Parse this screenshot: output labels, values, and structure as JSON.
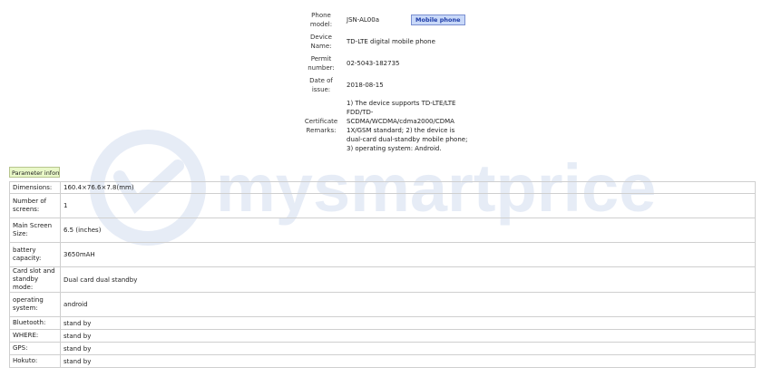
{
  "watermark": {
    "text": "mysmartprice"
  },
  "certificate": {
    "rows": [
      {
        "label": "Phone model:",
        "value": "JSN-AL00a",
        "tag": "Mobile phone"
      },
      {
        "label": "Device Name:",
        "value": "TD-LTE digital mobile phone"
      },
      {
        "label": "Permit number:",
        "value": "02-5043-182735"
      },
      {
        "label": "Date of issue:",
        "value": "2018-08-15"
      },
      {
        "label": "Certificate Remarks:",
        "value": "1) The device supports TD-LTE/LTE FDD/TD-SCDMA/WCDMA/cdma2000/CDMA 1X/GSM standard; 2) the device is dual-card dual-standby mobile phone; 3) operating system: Android."
      }
    ]
  },
  "parameters": {
    "title": "Parameter inform",
    "rows": [
      {
        "label": "Dimensions:",
        "value": "160.4×76.6×7.8(mm)"
      },
      {
        "label": "Number of screens:",
        "value": "1"
      },
      {
        "label": "Main Screen Size:",
        "value": "6.5 (inches)"
      },
      {
        "label": "battery capacity:",
        "value": "3650mAH"
      },
      {
        "label": "Card slot and standby mode:",
        "value": "Dual card dual standby"
      },
      {
        "label": "operating system:",
        "value": "android"
      },
      {
        "label": "Bluetooth:",
        "value": "stand by"
      },
      {
        "label": "WHERE:",
        "value": "stand by"
      },
      {
        "label": "GPS:",
        "value": "stand by"
      },
      {
        "label": "Hokuto:",
        "value": "stand by"
      }
    ]
  }
}
